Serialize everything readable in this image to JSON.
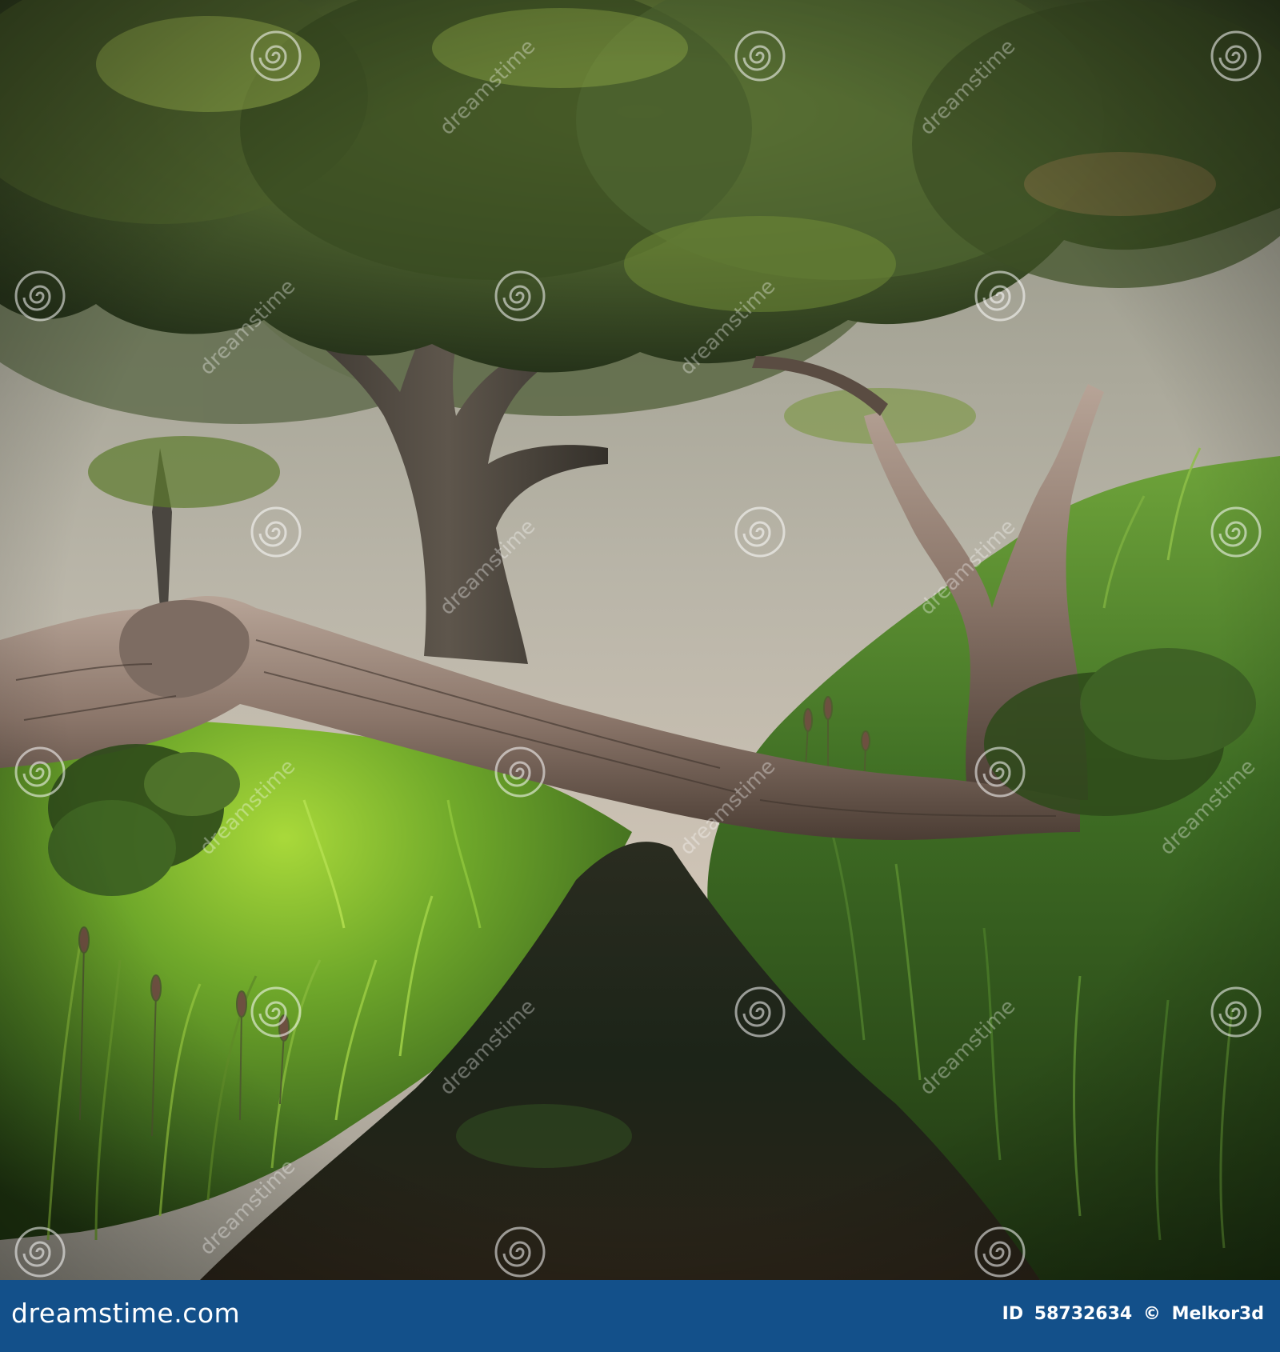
{
  "scene": {
    "description_elements": [
      "canopy",
      "sky",
      "tree-trunks",
      "fallen-log",
      "grass-banks",
      "stream",
      "cattails"
    ],
    "colors": {
      "sky_light": "#c9c1b4",
      "sky_dark": "#8c8a82",
      "canopy_dark": "#2c3a1c",
      "canopy_light": "#7f9a3c",
      "grass_bright": "#8ac832",
      "grass_dark": "#2f4a1a",
      "bark": "#8a766a",
      "bark_dark": "#4a3e36",
      "water": "#1d1f14"
    }
  },
  "watermark": {
    "text": "dreamstime",
    "color": "#ffffff"
  },
  "footer": {
    "logo_text": "dreamstime.com",
    "id_label": "ID",
    "id_value": "58732634",
    "copyright": "©",
    "author": "Melkor3d",
    "background": "#13508a"
  }
}
